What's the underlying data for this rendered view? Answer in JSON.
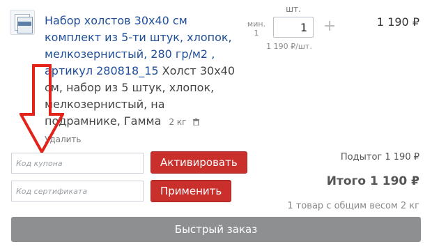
{
  "product": {
    "title": "Набор холстов 30х40 см комплект из 5-ти штук, хлопок, мелкозернистый, 280 гр/м2 , артикул 280818_15",
    "description": "Холст 30х40 см, набор из 5 штук, хлопок, мелкозернистый, на подрамнике, Гамма",
    "weight": "2 кг",
    "delete_label": "Удалить",
    "thumbnail_icon": "canvas-set-image"
  },
  "quantity": {
    "min_label": "мин.",
    "min_value": "1",
    "unit_label": "шт.",
    "value": "1",
    "plus_label": "+",
    "unit_price": "1 190 ₽/шт."
  },
  "line_total": "1 190 ₽",
  "coupon": {
    "placeholder": "Код купона",
    "button_label": "Активировать"
  },
  "certificate": {
    "placeholder": "Код сертификата",
    "button_label": "Применить"
  },
  "summary": {
    "subtotal": "Подытог 1 190 ₽",
    "total": "Итого 1 190 ₽",
    "weight_note": "1 товар с общим весом 2 кг"
  },
  "quick_order_label": "Быстрый заказ",
  "colors": {
    "link": "#1f4e9a",
    "action_button": "#c9302c",
    "quick_order_button": "#8e8f91",
    "annotation_arrow": "#e2231a"
  }
}
